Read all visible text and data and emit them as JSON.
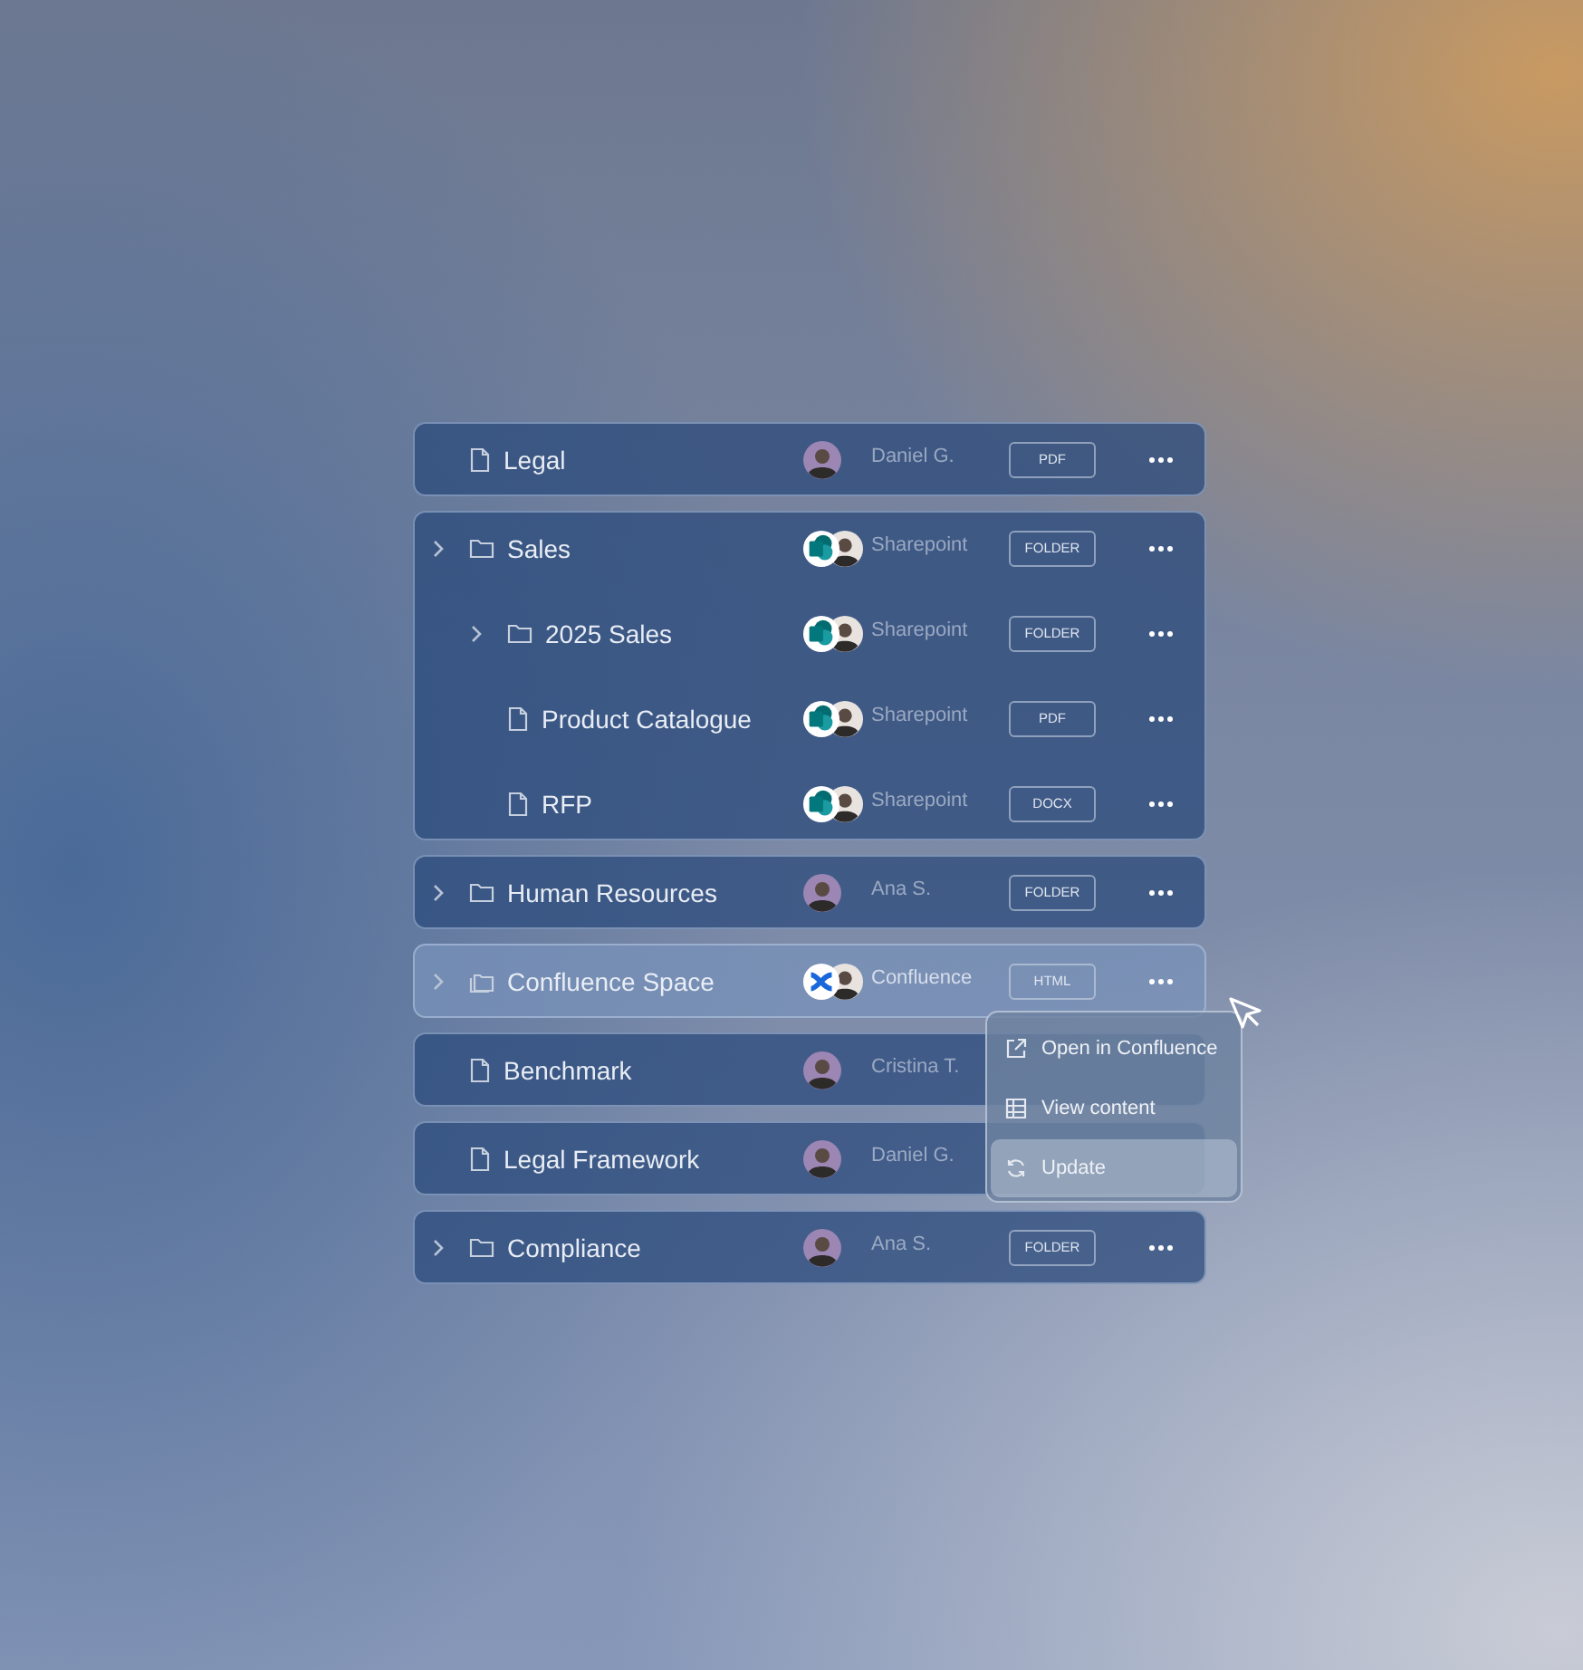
{
  "groups": [
    {
      "selected": false,
      "rows": [
        {
          "kind": "file",
          "name": "Legal",
          "source": {
            "kind": "person",
            "label": "Daniel G."
          },
          "tag": "PDF"
        }
      ]
    },
    {
      "selected": false,
      "rows": [
        {
          "kind": "folder",
          "name": "Sales",
          "source": {
            "kind": "sharepoint",
            "label": "Sharepoint"
          },
          "tag": "FOLDER",
          "children": [
            {
              "kind": "folder",
              "name": "2025 Sales",
              "source": {
                "kind": "sharepoint",
                "label": "Sharepoint"
              },
              "tag": "FOLDER"
            },
            {
              "kind": "file",
              "name": "Product Catalogue",
              "source": {
                "kind": "sharepoint",
                "label": "Sharepoint"
              },
              "tag": "PDF"
            },
            {
              "kind": "file",
              "name": "RFP",
              "source": {
                "kind": "sharepoint",
                "label": "Sharepoint"
              },
              "tag": "DOCX"
            }
          ]
        }
      ]
    },
    {
      "selected": false,
      "rows": [
        {
          "kind": "folder",
          "name": "Human Resources",
          "source": {
            "kind": "person",
            "label": "Ana S."
          },
          "tag": "FOLDER"
        }
      ]
    },
    {
      "selected": true,
      "rows": [
        {
          "kind": "space",
          "name": "Confluence Space",
          "source": {
            "kind": "confluence",
            "label": "Confluence"
          },
          "tag": "HTML"
        }
      ]
    },
    {
      "selected": false,
      "rows": [
        {
          "kind": "file",
          "name": "Benchmark",
          "source": {
            "kind": "person",
            "label": "Cristina T."
          }
        }
      ]
    },
    {
      "selected": false,
      "rows": [
        {
          "kind": "file",
          "name": "Legal Framework",
          "source": {
            "kind": "person",
            "label": "Daniel G."
          }
        }
      ]
    },
    {
      "selected": false,
      "rows": [
        {
          "kind": "folder",
          "name": "Compliance",
          "source": {
            "kind": "person",
            "label": "Ana S."
          },
          "tag": "FOLDER"
        }
      ]
    }
  ],
  "context_menu": {
    "items": [
      {
        "kind": "open",
        "label": "Open in Confluence",
        "selected": false
      },
      {
        "kind": "view",
        "label": "View content",
        "selected": false
      },
      {
        "kind": "update",
        "label": "Update",
        "selected": true
      }
    ]
  }
}
